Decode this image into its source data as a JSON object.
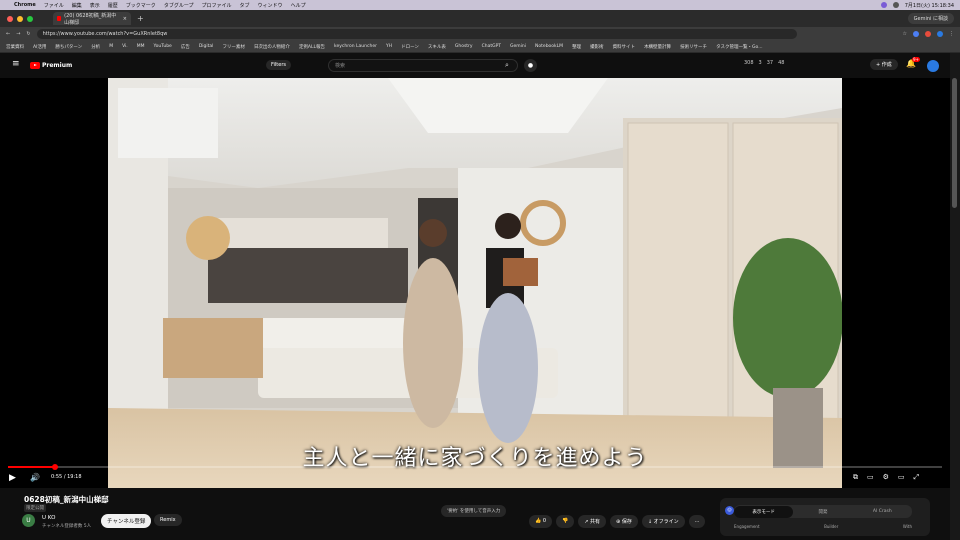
{
  "menubar": {
    "app": "Chrome",
    "items": [
      "ファイル",
      "編集",
      "表示",
      "履歴",
      "ブックマーク",
      "タブグループ",
      "プロファイル",
      "タブ",
      "ウィンドウ",
      "ヘルプ"
    ],
    "clock": "7月1日(火) 15:18:34"
  },
  "tab": {
    "title": "(20) 0628初稿_新潟中山梯邸"
  },
  "gemini": "Gemini に相談",
  "address": {
    "url": "https://www.youtube.com/watch?v=GuXRnIet8qw"
  },
  "bookmarks": [
    "営業資料",
    "AI活用",
    "勝ちパターン",
    "分析",
    "M",
    "Vi.",
    "MM",
    "YouTube",
    "広告",
    "Digital",
    "フリー素材",
    "日次出の人物紹介",
    "定例ALL報告",
    "keychron Launcher",
    "YH",
    "ドローン",
    "スキル表",
    "Ghostry",
    "ChatGPT",
    "Gemini",
    "NotebookLM",
    "整理",
    "撮影術",
    "資料サイト",
    "木構壁量計算",
    "技術リサーチ",
    "タスク管理一覧・Go..."
  ],
  "youtube": {
    "brand": "Premium",
    "filters": "Filters",
    "search_placeholder": "検索",
    "stats": [
      "308",
      "3",
      "37",
      "48"
    ],
    "create": "作成",
    "notif": "9+"
  },
  "video": {
    "subtitle": "主人と一緒に家づくりを進めよう",
    "time": "0:55 / 19:18",
    "progress": 0.05
  },
  "below": {
    "title": "0628初稿_新潟中山梯邸",
    "subtag": "限定公開",
    "channel": "U KO",
    "subs": "チャンネル登録者数 5人",
    "subscribe": "チャンネル登録",
    "remix": "Remix",
    "summary": "'要約' を使用して音声入力",
    "like": "0",
    "share": "共有",
    "save": "保存",
    "offline": "オフライン",
    "more": "..."
  },
  "modes": {
    "tabs": [
      "表示モード",
      "開発",
      "AI Crash"
    ],
    "labels": [
      "Engagement",
      "Builder",
      "With"
    ]
  },
  "colors": {
    "accent": "#ff0000",
    "panel": "#272727"
  }
}
